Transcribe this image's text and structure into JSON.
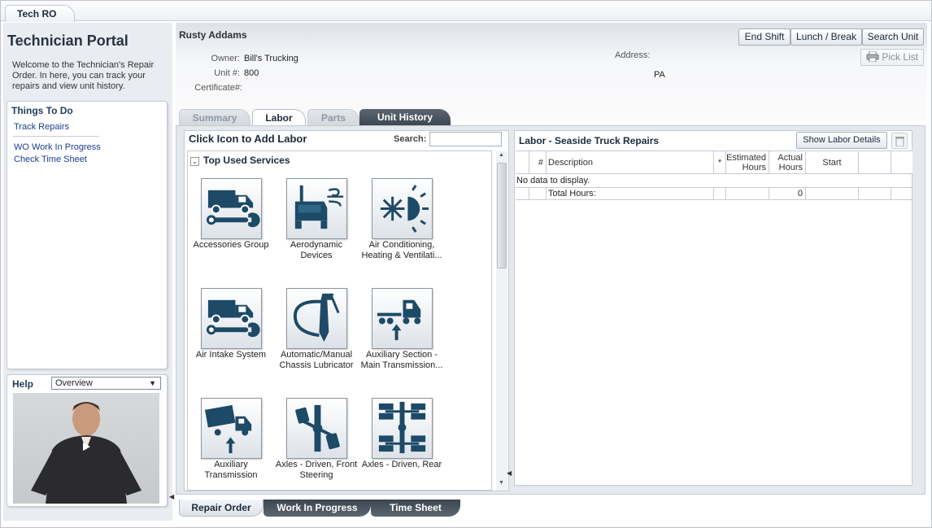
{
  "top_tab": "Tech RO",
  "sidebar": {
    "title": "Technician Portal",
    "welcome": "Welcome to the Technician's Repair Order. In here, you can track your repairs and view unit history.",
    "todo_title": "Things To Do",
    "links": [
      "Track Repairs",
      "WO Work In Progress",
      "Check Time Sheet"
    ],
    "help_title": "Help",
    "help_select": "Overview"
  },
  "header": {
    "tech_name": "Rusty Addams",
    "owner_label": "Owner:",
    "owner_value": "Bill's Trucking",
    "unit_label": "Unit #:",
    "unit_value": "800",
    "cert_label": "Certificate#:",
    "cert_value": "",
    "address_label": "Address:",
    "address_state": "PA",
    "buttons": [
      "End Shift",
      "Lunch / Break",
      "Search Unit"
    ],
    "pick_list": "Pick List"
  },
  "tabs": [
    "Summary",
    "Labor",
    "Parts",
    "Unit History"
  ],
  "labor": {
    "title": "Click Icon to Add Labor",
    "search_label": "Search:",
    "search_value": "",
    "section_title": "Top Used Services",
    "services": [
      {
        "label": "Accessories Group",
        "icon": "truck-wrench-icon"
      },
      {
        "label": "Aerodynamic Devices",
        "icon": "truck-wind-icon"
      },
      {
        "label": "Air Conditioning, Heating & Ventilati...",
        "icon": "snowflake-sun-icon"
      },
      {
        "label": "Air Intake System",
        "icon": "truck-wrench-icon"
      },
      {
        "label": "Automatic/Manual Chassis Lubricator",
        "icon": "grease-gun-icon"
      },
      {
        "label": "Auxiliary Section - Main Transmission...",
        "icon": "tractor-arrow-icon"
      },
      {
        "label": "Auxiliary Transmission",
        "icon": "dump-truck-arrow-icon"
      },
      {
        "label": "Axles - Driven, Front Steering",
        "icon": "front-axle-icon"
      },
      {
        "label": "Axles - Driven, Rear",
        "icon": "rear-axle-icon"
      }
    ]
  },
  "grid": {
    "title": "Labor - Seaside Truck Repairs",
    "show_details": "Show Labor Details",
    "columns": [
      "#",
      "Description",
      "*",
      "Estimated Hours",
      "Actual Hours",
      "Start"
    ],
    "col_est_1": "Estimated",
    "col_est_2": "Hours",
    "col_act_1": "Actual",
    "col_act_2": "Hours",
    "empty": "No data to display.",
    "total_label": "Total Hours:",
    "total_value": "0"
  },
  "bottom_tabs": [
    "Repair Order",
    "Work In Progress",
    "Time Sheet"
  ]
}
